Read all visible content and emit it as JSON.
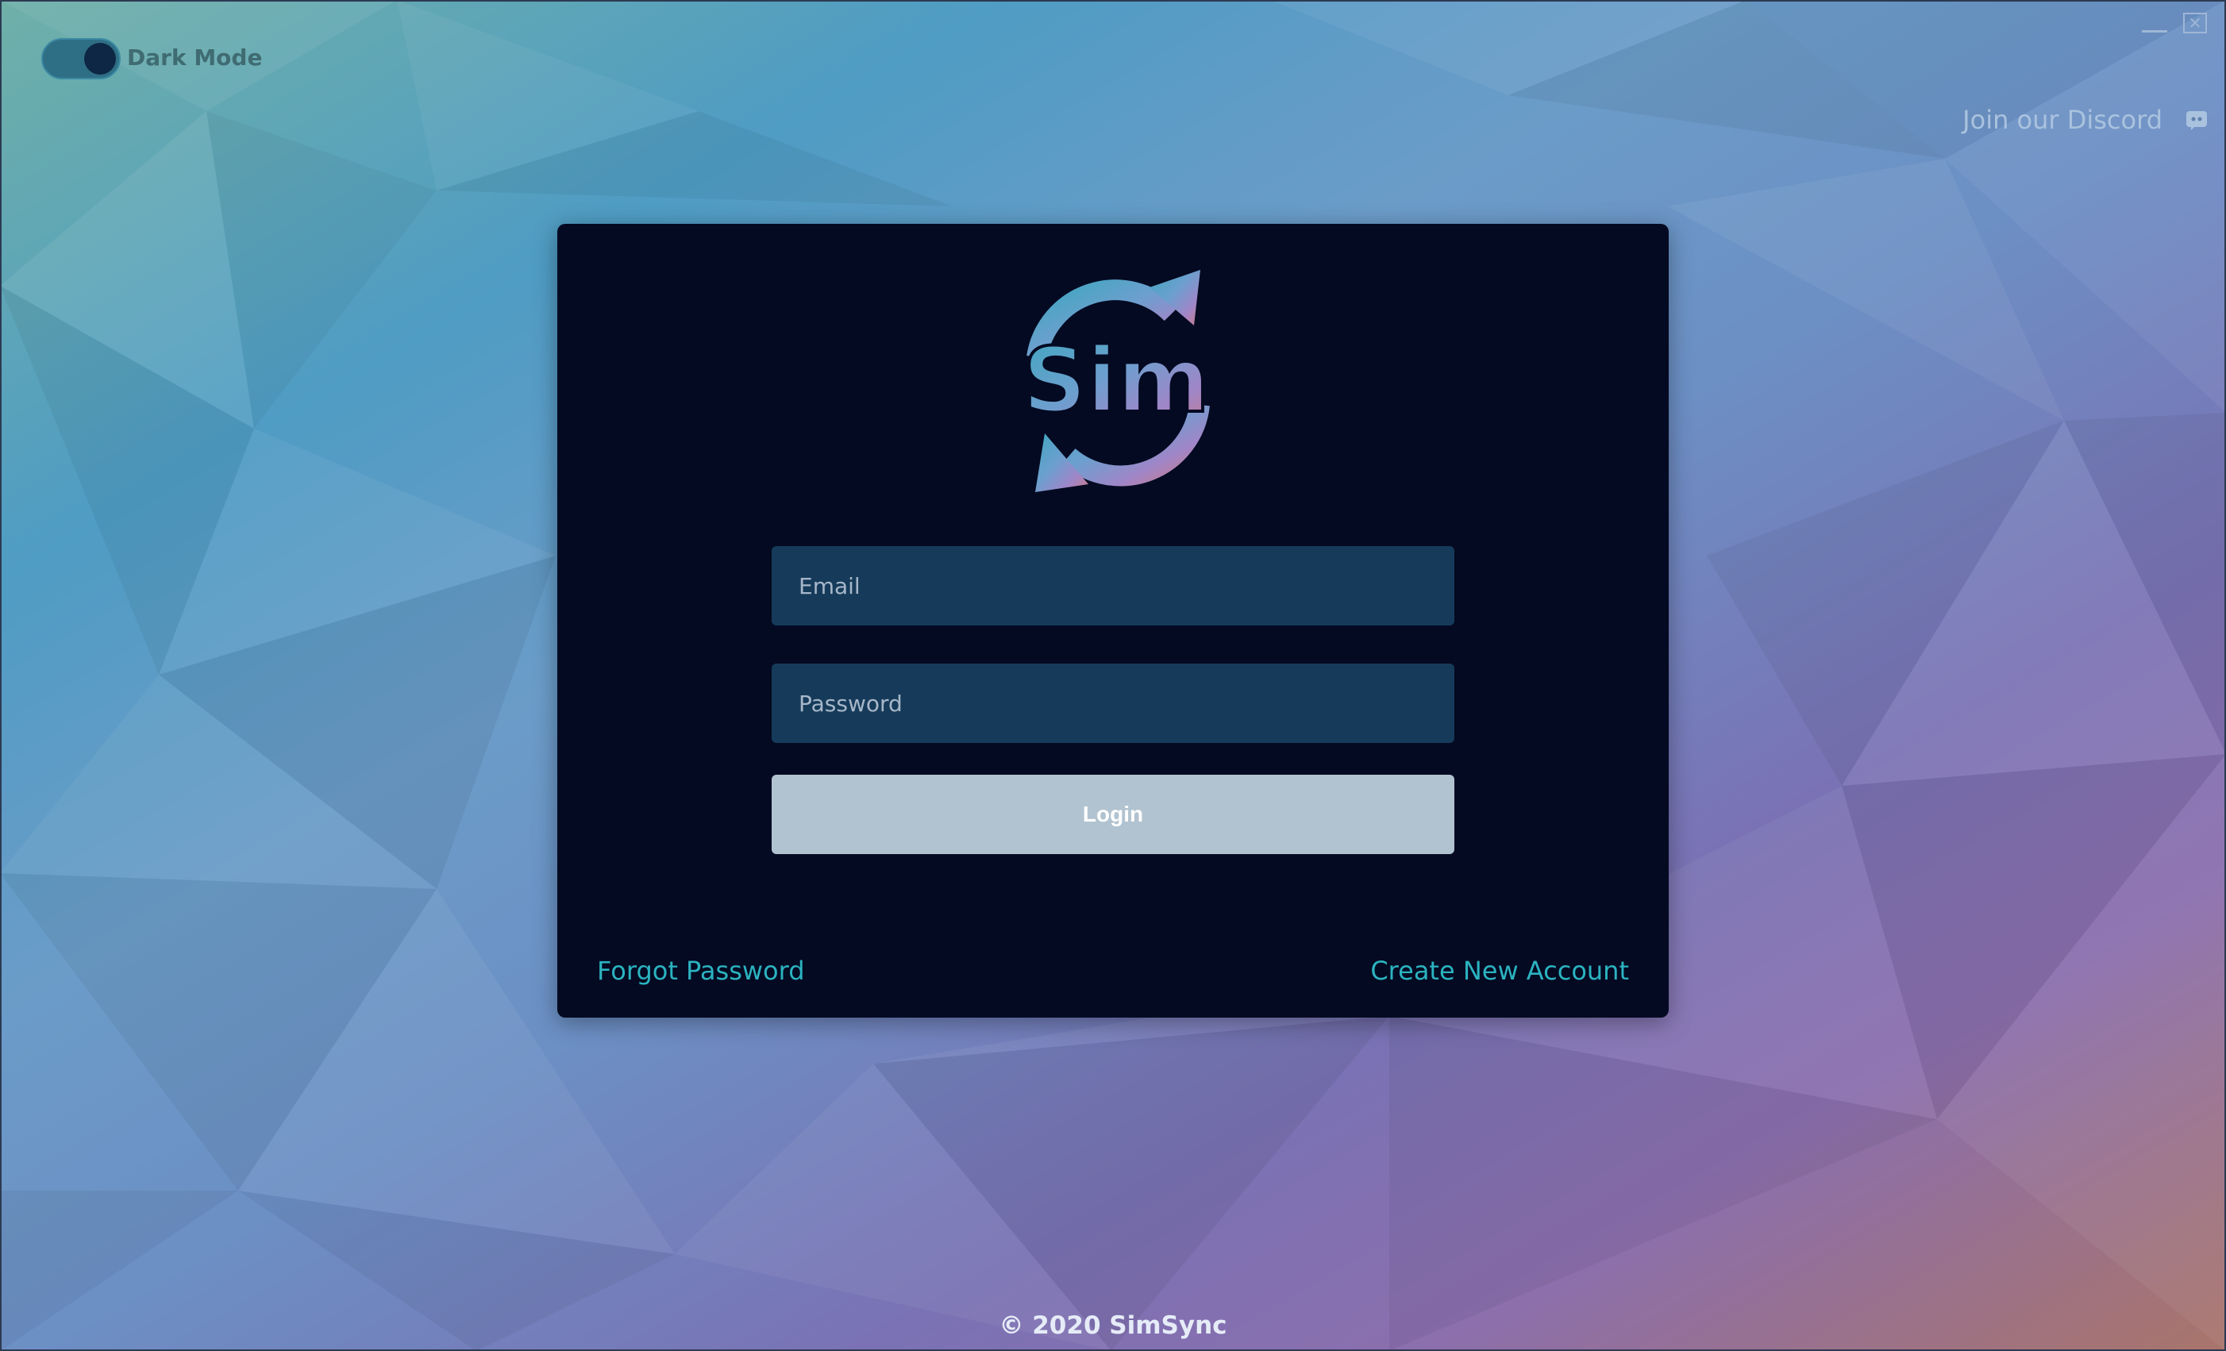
{
  "toggle": {
    "label": "Dark Mode",
    "state": "on"
  },
  "window_controls": {
    "close_glyph": "✕"
  },
  "discord": {
    "label": "Join our Discord",
    "icon": "discord-icon"
  },
  "login_form": {
    "email_placeholder": "Email",
    "email_value": "",
    "password_placeholder": "Password",
    "password_value": "",
    "login_label": "Login",
    "forgot_label": "Forgot Password",
    "create_label": "Create New Account"
  },
  "logo": {
    "text": "Sim"
  },
  "footer": {
    "text": "© 2020 SimSync"
  },
  "colors": {
    "card_background": "#040a22",
    "input_background": "#163b5a",
    "login_button": "#b1c3d0",
    "link_accent": "#2bb3c0"
  }
}
